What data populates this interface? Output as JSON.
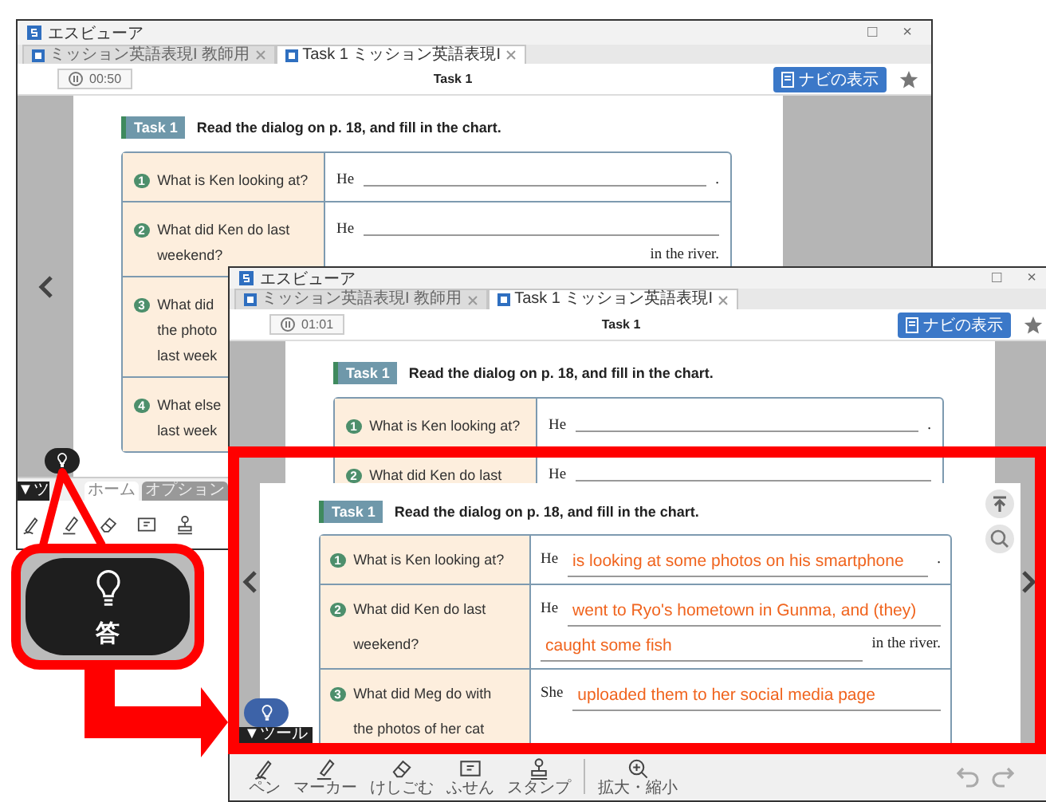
{
  "back_window": {
    "title": "エスビューア",
    "window_controls": [
      "□",
      "×"
    ],
    "tabs": [
      {
        "label": "ミッション英語表現I 教師用",
        "selected": false
      },
      {
        "label": "Task 1 ミッション英語表現I",
        "selected": true
      }
    ],
    "timer": "00:50",
    "page_title": "Task 1",
    "nav_button": "ナビの表示",
    "task": {
      "badge": "Task 1",
      "instruction": "Read the dialog on p. 18, and fill in the chart."
    },
    "rows": [
      {
        "number": "1",
        "question_lines": [
          "What is Ken looking at?"
        ],
        "answer_lines": [
          [
            {
              "kind": "word",
              "text": "He"
            },
            {
              "kind": "blank"
            },
            {
              "kind": "word",
              "text": "."
            }
          ]
        ]
      },
      {
        "number": "2",
        "question_lines": [
          "What did Ken do last",
          "weekend?"
        ],
        "answer_lines": [
          [
            {
              "kind": "word",
              "text": "He"
            },
            {
              "kind": "blank"
            }
          ],
          [
            {
              "kind": "word",
              "text": "in the river."
            }
          ]
        ]
      },
      {
        "number": "3",
        "question_lines": [
          "What did",
          "the photo",
          "last week"
        ],
        "answer_lines": []
      },
      {
        "number": "4",
        "question_lines": [
          "What else",
          "last week"
        ],
        "answer_lines": []
      }
    ],
    "tool_toggle": "▼ツ",
    "toolbar_tabs": [
      {
        "label": "ホーム",
        "selected": true
      },
      {
        "label": "オプション",
        "selected": false
      }
    ],
    "tools": [
      {
        "kind": "pen"
      },
      {
        "kind": "marker"
      },
      {
        "kind": "eraser"
      },
      {
        "kind": "note"
      },
      {
        "kind": "stamp"
      }
    ]
  },
  "front_window": {
    "title": "エスビューア",
    "window_controls": [
      "□",
      "×"
    ],
    "tabs": [
      {
        "label": "ミッション英語表現I 教師用",
        "selected": false
      },
      {
        "label": "Task 1 ミッション英語表現I",
        "selected": true
      }
    ],
    "timer": "01:01",
    "page_title": "Task 1",
    "nav_button": "ナビの表示",
    "task": {
      "badge": "Task 1",
      "instruction": "Read the dialog on p. 18, and fill in the chart."
    },
    "rows": [
      {
        "number": "1",
        "question_lines": [
          "What is Ken looking at?"
        ],
        "answer_lines": [
          [
            {
              "kind": "word",
              "text": "He"
            },
            {
              "kind": "blank"
            },
            {
              "kind": "word",
              "text": "."
            }
          ]
        ]
      },
      {
        "number": "2",
        "question_lines": [
          "What did Ken do last"
        ],
        "answer_lines": [
          [
            {
              "kind": "word",
              "text": "He"
            },
            {
              "kind": "blank"
            }
          ]
        ]
      }
    ],
    "tools": [
      {
        "kind": "pen",
        "label": "ペン"
      },
      {
        "kind": "marker",
        "label": "マーカー"
      },
      {
        "kind": "eraser",
        "label": "けしごむ"
      },
      {
        "kind": "note",
        "label": "ふせん"
      },
      {
        "kind": "stamp",
        "label": "スタンプ"
      },
      {
        "kind": "zoom",
        "label": "拡大・縮小"
      }
    ]
  },
  "zoom_view": {
    "task": {
      "badge": "Task 1",
      "instruction": "Read the dialog on p. 18, and fill in the chart."
    },
    "rows": [
      {
        "number": "1",
        "question_lines": [
          "What is Ken looking at?"
        ],
        "answer_lines": [
          [
            {
              "kind": "word",
              "text": "He"
            },
            {
              "kind": "blank",
              "text": "is looking at some photos on his smartphone"
            },
            {
              "kind": "word",
              "text": "."
            }
          ]
        ]
      },
      {
        "number": "2",
        "question_lines": [
          "What did Ken do last",
          "weekend?"
        ],
        "answer_lines": [
          [
            {
              "kind": "word",
              "text": "He"
            },
            {
              "kind": "blank",
              "text": "went to Ryo's hometown in Gunma, and (they)"
            }
          ],
          [
            {
              "kind": "blank",
              "text": "caught some fish"
            },
            {
              "kind": "word",
              "text": "in the river."
            }
          ]
        ]
      },
      {
        "number": "3",
        "question_lines": [
          "What did Meg do with",
          "the photos of her cat"
        ],
        "answer_lines": [
          [
            {
              "kind": "word",
              "text": "She"
            },
            {
              "kind": "blank",
              "text": "uploaded them to her social media page"
            }
          ]
        ]
      }
    ],
    "tool_toggle": "▼ツール"
  },
  "callout": {
    "label": "答"
  }
}
